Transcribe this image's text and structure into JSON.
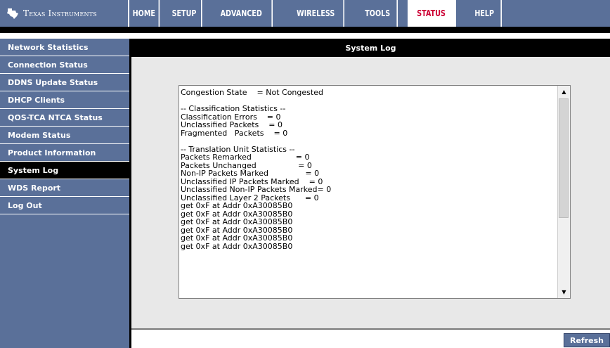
{
  "brand": {
    "name": "Texas Instruments"
  },
  "nav": {
    "tabs": [
      {
        "label": "HOME"
      },
      {
        "label": "SETUP"
      },
      {
        "label": "ADVANCED"
      },
      {
        "label": "WIRELESS"
      },
      {
        "label": "TOOLS"
      },
      {
        "label": "STATUS",
        "active": true
      },
      {
        "label": "HELP"
      }
    ]
  },
  "sidebar": {
    "items": [
      {
        "label": "Network Statistics"
      },
      {
        "label": "Connection Status"
      },
      {
        "label": "DDNS Update Status"
      },
      {
        "label": "DHCP Clients"
      },
      {
        "label": "QOS-TCA NTCA Status"
      },
      {
        "label": "Modem Status"
      },
      {
        "label": "Product Information"
      },
      {
        "label": "System Log",
        "active": true
      },
      {
        "label": "WDS Report"
      },
      {
        "label": "Log Out"
      }
    ]
  },
  "main": {
    "title": "System Log",
    "log_text": "Congestion State    = Not Congested\n\n-- Classification Statistics --\nClassification Errors    = 0\nUnclassified Packets    = 0\nFragmented   Packets    = 0\n\n-- Translation Unit Statistics --\nPackets Remarked                  = 0\nPackets Unchanged                 = 0\nNon-IP Packets Marked               = 0\nUnclassified IP Packets Marked    = 0\nUnclassified Non-IP Packets Marked= 0\nUnclassified Layer 2 Packets      = 0\nget 0xF at Addr 0xA30085B0\nget 0xF at Addr 0xA30085B0\nget 0xF at Addr 0xA30085B0\nget 0xF at Addr 0xA30085B0\nget 0xF at Addr 0xA30085B0\nget 0xF at Addr 0xA30085B0",
    "refresh_label": "Refresh"
  },
  "colors": {
    "nav_bg": "#5a7099",
    "active_tab_text": "#cc0033"
  }
}
